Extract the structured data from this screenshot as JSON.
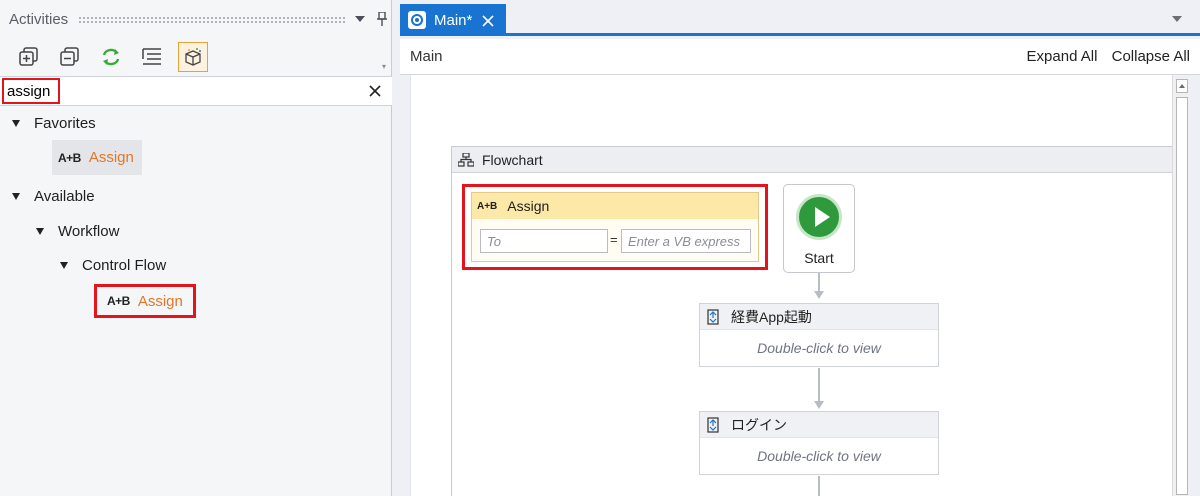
{
  "activities_panel": {
    "title": "Activities",
    "search": {
      "value": "assign"
    },
    "tree": {
      "favorites": {
        "label": "Favorites",
        "items": [
          {
            "icon_text": "A+B",
            "label": "Assign"
          }
        ]
      },
      "available": {
        "label": "Available",
        "workflow": {
          "label": "Workflow",
          "control_flow": {
            "label": "Control Flow",
            "items": [
              {
                "icon_text": "A+B",
                "label": "Assign"
              }
            ]
          }
        }
      }
    },
    "toolbar_icons": [
      "expand-all-icon",
      "collapse-all-icon",
      "refresh-icon",
      "show-list-icon",
      "filter-icon"
    ]
  },
  "document": {
    "tab": {
      "label": "Main*"
    },
    "breadcrumb": "Main",
    "expand_all": "Expand All",
    "collapse_all": "Collapse All"
  },
  "flowchart": {
    "title": "Flowchart",
    "assign": {
      "icon_text": "A+B",
      "title": "Assign",
      "to_placeholder": "To",
      "equals": "=",
      "value_placeholder": "Enter a VB express"
    },
    "start": {
      "label": "Start"
    },
    "sequences": [
      {
        "title": "経費App起動",
        "body": "Double-click to view"
      },
      {
        "title": "ログイン",
        "body": "Double-click to view"
      }
    ]
  },
  "colors": {
    "accent_blue": "#1874d0",
    "highlight_red": "#e3141c",
    "activity_orange": "#e2762b",
    "start_green": "#2f9a3c"
  }
}
